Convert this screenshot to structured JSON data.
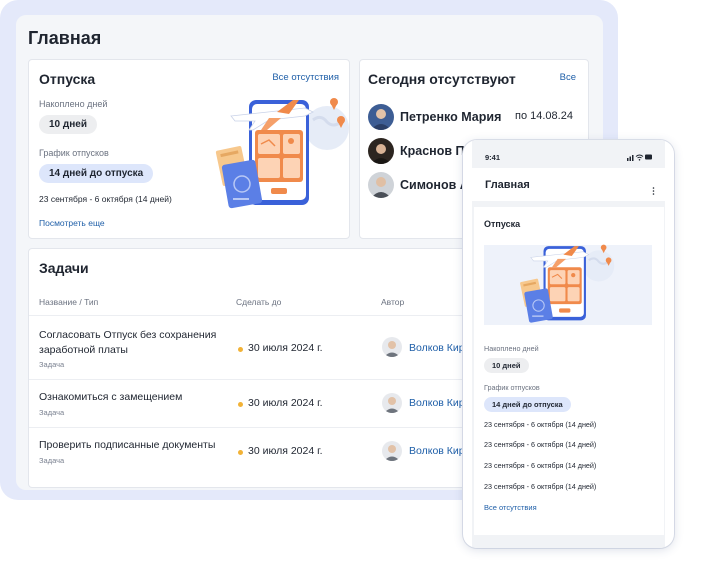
{
  "desktop": {
    "page_title": "Главная",
    "vacations": {
      "title": "Отпуска",
      "all_absences_link": "Все отсутствия",
      "accrued_label": "Накоплено дней",
      "accrued_value": "10 дней",
      "schedule_label": "График отпусков",
      "days_until": "14 дней до отпуска",
      "period": "23 сентября - 6 октября (14 дней)",
      "see_more_link": "Посмотреть еще"
    },
    "today_absent": {
      "title": "Сегодня отсутствуют",
      "all_link": "Все",
      "people": [
        {
          "name": "Петренко Мария",
          "until": "по 14.08.24"
        },
        {
          "name": "Краснов Павел",
          "until": ""
        },
        {
          "name": "Симонов Алексей",
          "until": ""
        }
      ]
    },
    "tasks": {
      "title": "Задачи",
      "columns": [
        "Название / Тип",
        "Сделать до",
        "Автор"
      ],
      "rows": [
        {
          "title": "Согласовать Отпуск без сохранения заработной платы",
          "type": "Задача",
          "due": "30 июля 2024 г.",
          "author": "Волков Кирилл"
        },
        {
          "title": "Ознакомиться с замещением",
          "type": "Задача",
          "due": "30 июля 2024 г.",
          "author": "Волков Кирилл"
        },
        {
          "title": "Проверить подписанные документы",
          "type": "Задача",
          "due": "30 июля 2024 г.",
          "author": "Волков Кирилл"
        }
      ]
    }
  },
  "mobile": {
    "status_time": "9:41",
    "header_title": "Главная",
    "vacations_title": "Отпуска",
    "accrued_label": "Накоплено дней",
    "accrued_value": "10 дней",
    "schedule_label": "График отпусков",
    "days_until": "14 дней до отпуска",
    "periods": [
      "23 сентября - 6 октября (14 дней)",
      "23 сентября - 6 октября (14 дней)",
      "23 сентября - 6 октября (14 дней)",
      "23 сентября - 6 октября (14 дней)"
    ],
    "all_absences_link": "Все отсутствия"
  },
  "colors": {
    "accent_link": "#1f5fa8",
    "due_dot": "#f2b236",
    "illustration_orange": "#f08a4b",
    "illustration_blue": "#5b7fe6",
    "backdrop": "#e4e9fa"
  }
}
